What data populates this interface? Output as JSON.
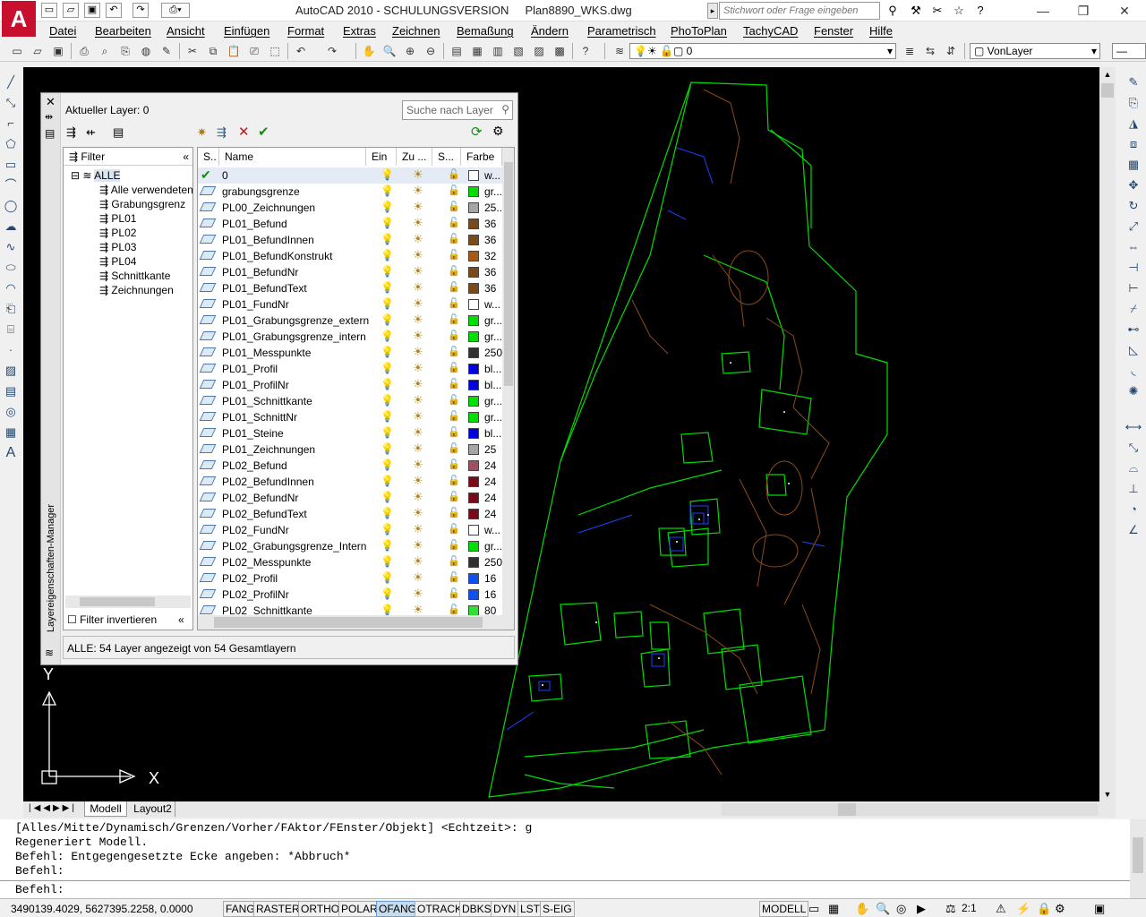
{
  "title_bar": {
    "app_title": "AutoCAD 2010 - SCHULUNGSVERSION",
    "file_name": "Plan8890_WKS.dwg",
    "search_placeholder": "Stichwort oder Frage eingeben"
  },
  "menu": [
    "Datei",
    "Bearbeiten",
    "Ansicht",
    "Einfügen",
    "Format",
    "Extras",
    "Zeichnen",
    "Bemaßung",
    "Ändern",
    "Parametrisch",
    "PhoToPlan",
    "TachyCAD",
    "Fenster",
    "Hilfe"
  ],
  "toolbar": {
    "layer_combo": "0",
    "color_combo": "VonLayer"
  },
  "layer_manager": {
    "title": "Layereigenschaften-Manager",
    "current_layer": "Aktueller Layer: 0",
    "search_placeholder": "Suche nach Layer",
    "filter_header": "Filter",
    "filter_tree": [
      "ALLE",
      "Alle verwendeten",
      "Grabungsgrenz",
      "PL01",
      "PL02",
      "PL03",
      "PL04",
      "Schnittkante",
      "Zeichnungen"
    ],
    "invert_filter": "Filter invertieren",
    "columns": [
      "S..",
      "Name",
      "Ein",
      "Zu ...",
      "S...",
      "Farbe"
    ],
    "status": "ALLE: 54 Layer angezeigt von 54 Gesamtlayern",
    "layers": [
      {
        "name": "0",
        "color": "#ffffff",
        "color_label": "w..."
      },
      {
        "name": "grabungsgrenze",
        "color": "#00e000",
        "color_label": "gr..."
      },
      {
        "name": "PL00_Zeichnungen",
        "color": "#a5a5a5",
        "color_label": "25..."
      },
      {
        "name": "PL01_Befund",
        "color": "#7a4a1a",
        "color_label": "36"
      },
      {
        "name": "PL01_BefundInnen",
        "color": "#7a4a1a",
        "color_label": "36"
      },
      {
        "name": "PL01_BefundKonstrukt",
        "color": "#a85a10",
        "color_label": "32"
      },
      {
        "name": "PL01_BefundNr",
        "color": "#7a4a1a",
        "color_label": "36"
      },
      {
        "name": "PL01_BefundText",
        "color": "#7a4a1a",
        "color_label": "36"
      },
      {
        "name": "PL01_FundNr",
        "color": "#ffffff",
        "color_label": "w..."
      },
      {
        "name": "PL01_Grabungsgrenze_extern",
        "color": "#00e000",
        "color_label": "gr..."
      },
      {
        "name": "PL01_Grabungsgrenze_intern",
        "color": "#00e000",
        "color_label": "gr..."
      },
      {
        "name": "PL01_Messpunkte",
        "color": "#303030",
        "color_label": "250"
      },
      {
        "name": "PL01_Profil",
        "color": "#0000e0",
        "color_label": "bl..."
      },
      {
        "name": "PL01_ProfilNr",
        "color": "#0000e0",
        "color_label": "bl..."
      },
      {
        "name": "PL01_Schnittkante",
        "color": "#00e000",
        "color_label": "gr..."
      },
      {
        "name": "PL01_SchnittNr",
        "color": "#00e000",
        "color_label": "gr..."
      },
      {
        "name": "PL01_Steine",
        "color": "#0000e0",
        "color_label": "bl..."
      },
      {
        "name": "PL01_Zeichnungen",
        "color": "#a5a5a5",
        "color_label": "25"
      },
      {
        "name": "PL02_Befund",
        "color": "#a05060",
        "color_label": "24"
      },
      {
        "name": "PL02_BefundInnen",
        "color": "#7a0a1a",
        "color_label": "24"
      },
      {
        "name": "PL02_BefundNr",
        "color": "#7a0a1a",
        "color_label": "24"
      },
      {
        "name": "PL02_BefundText",
        "color": "#7a0a1a",
        "color_label": "24"
      },
      {
        "name": "PL02_FundNr",
        "color": "#ffffff",
        "color_label": "w..."
      },
      {
        "name": "PL02_Grabungsgrenze_Intern",
        "color": "#00e000",
        "color_label": "gr..."
      },
      {
        "name": "PL02_Messpunkte",
        "color": "#303030",
        "color_label": "250"
      },
      {
        "name": "PL02_Profil",
        "color": "#1050f0",
        "color_label": "16"
      },
      {
        "name": "PL02_ProfilNr",
        "color": "#1050f0",
        "color_label": "16"
      },
      {
        "name": "PL02_Schnittkante",
        "color": "#30e030",
        "color_label": "80"
      }
    ]
  },
  "layout_tabs": [
    "Modell",
    "Layout2"
  ],
  "command_lines": [
    "[Alles/Mitte/Dynamisch/Grenzen/Vorher/FAktor/FEnster/Objekt] <Echtzeit>: g",
    "Regeneriert Modell.",
    "Befehl: Entgegengesetzte Ecke angeben: *Abbruch*",
    "Befehl:",
    "Befehl:"
  ],
  "status_bar": {
    "coords": "3490139.4029, 5627395.2258, 0.0000",
    "toggles": [
      "FANG",
      "RASTER",
      "ORTHO",
      "POLAR",
      "OFANG",
      "OTRACK",
      "DBKS",
      "DYN",
      "LST",
      "S-EIG"
    ],
    "active_toggle": "OFANG",
    "model_label": "MODELL",
    "scale": "2:1"
  }
}
